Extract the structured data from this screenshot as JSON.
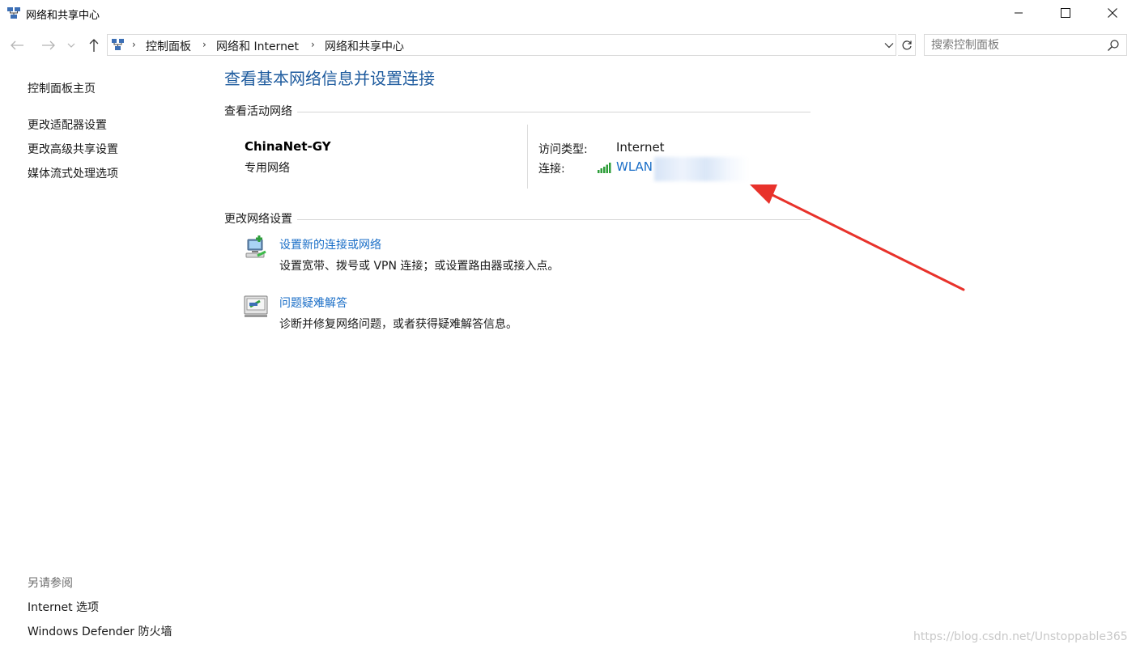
{
  "window": {
    "title": "网络和共享中心",
    "minimize_icon": "minimize-icon",
    "maximize_icon": "maximize-icon",
    "close_icon": "close-icon"
  },
  "address_bar": {
    "breadcrumbs": [
      "控制面板",
      "网络和 Internet",
      "网络和共享中心"
    ],
    "separator": "›"
  },
  "search": {
    "placeholder": "搜索控制面板",
    "value": ""
  },
  "left_nav": {
    "home": "控制面板主页",
    "items": [
      "更改适配器设置",
      "更改高级共享设置",
      "媒体流式处理选项"
    ],
    "see_also_title": "另请参阅",
    "see_also": [
      "Internet 选项",
      "Windows Defender 防火墙"
    ]
  },
  "main": {
    "title": "查看基本网络信息并设置连接",
    "active_networks": {
      "heading": "查看活动网络",
      "network_name": "ChinaNet-GY",
      "network_type": "专用网络",
      "access_type_label": "访问类型:",
      "access_type_value": "Internet",
      "connection_label": "连接:",
      "connection_value": "WLAN"
    },
    "change_settings": {
      "heading": "更改网络设置",
      "tasks": [
        {
          "title": "设置新的连接或网络",
          "desc": "设置宽带、拨号或 VPN 连接；或设置路由器或接入点。",
          "icon": "new-connection-icon"
        },
        {
          "title": "问题疑难解答",
          "desc": "诊断并修复网络问题，或者获得疑难解答信息。",
          "icon": "troubleshoot-icon"
        }
      ]
    }
  },
  "watermark": "https://blog.csdn.net/Unstoppable365",
  "colors": {
    "link": "#1a6ec7",
    "title": "#1e5b9e",
    "arrow": "#e8322b",
    "signal": "#2e9e3a"
  }
}
